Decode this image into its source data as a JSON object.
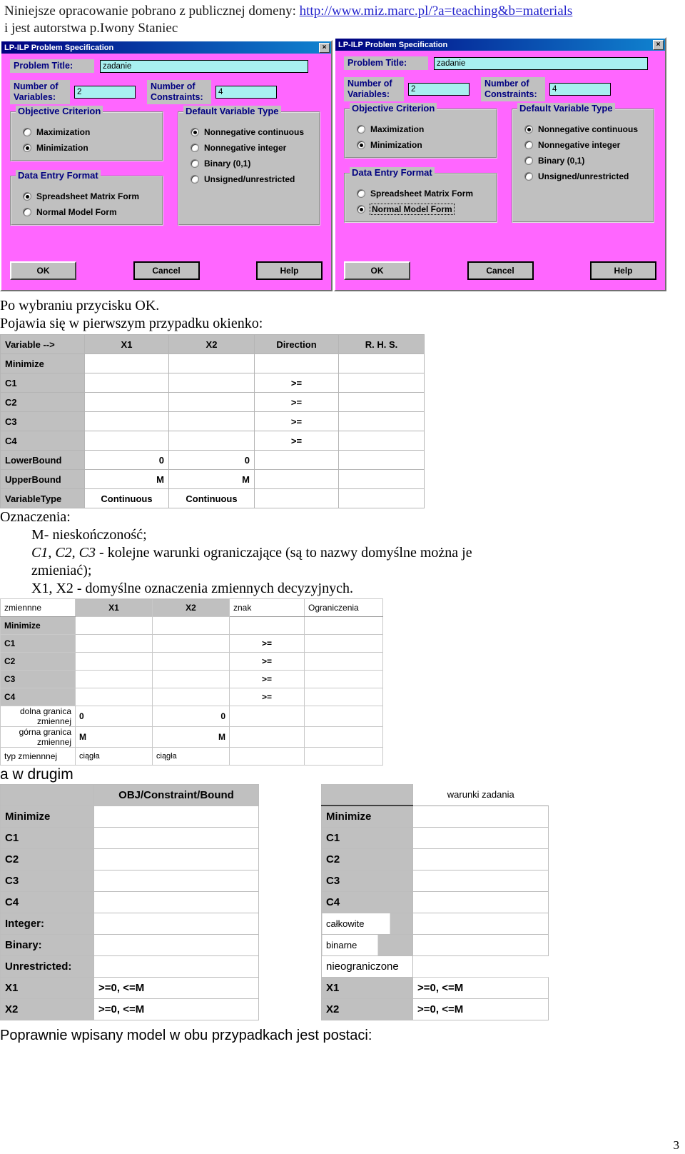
{
  "header": {
    "line1_prefix": "Niniejsze opracowanie pobrano z publicznej domeny: ",
    "link_text": "http://www.miz.marc.pl/?a=teaching&b=materials",
    "line2": "i jest autorstwa p.Iwony Staniec"
  },
  "dialog": {
    "title": "LP-ILP Problem Specification",
    "close_label": "×",
    "problem_title_label": "Problem Title:",
    "problem_title_value": "zadanie",
    "num_variables_label": "Number of\nVariables:",
    "num_variables_label_l1": "Number of",
    "num_variables_label_l2": "Variables:",
    "num_variables_value": "2",
    "num_constraints_label_l1": "Number of",
    "num_constraints_label_l2": "Constraints:",
    "num_constraints_value": "4",
    "objective_group": "Objective Criterion",
    "objective_options": [
      "Maximization",
      "Minimization"
    ],
    "data_entry_group": "Data Entry Format",
    "data_entry_options": [
      "Spreadsheet Matrix Form",
      "Normal Model Form"
    ],
    "variable_type_group": "Default Variable Type",
    "variable_type_options": [
      "Nonnegative continuous",
      "Nonnegative integer",
      "Binary (0,1)",
      "Unsigned/unrestricted"
    ],
    "buttons": {
      "ok": "OK",
      "cancel": "Cancel",
      "help": "Help"
    },
    "instance_a": {
      "objective_selected": 1,
      "data_entry_selected": 0,
      "variable_type_selected": 0
    },
    "instance_b": {
      "objective_selected": 1,
      "data_entry_selected": 1,
      "variable_type_selected": 0
    }
  },
  "body": {
    "after_ok": "Po wybraniu przycisku OK.",
    "first_case": "Pojawia się w pierwszym przypadku okienko:",
    "legend_title": "Oznaczenia:",
    "legend_m": "M- nieskończoność;",
    "legend_c_italic": "C1, C2, C3",
    "legend_c_rest": " - kolejne warunki ograniczające (są to nazwy domyślne można je",
    "legend_c_rest2": "zmieniać);",
    "legend_x": "X1, X2 - domyślne oznaczenia zmiennych decyzyjnych.",
    "second_case": "a w drugim",
    "closing": "Poprawnie wpisany model w obu przypadkach jest postaci:",
    "page_number": "3"
  },
  "table_spreadsheet_en": {
    "columns": [
      "Variable -->",
      "X1",
      "X2",
      "Direction",
      "R. H. S."
    ],
    "rows": [
      {
        "label": "Minimize",
        "x1": "",
        "x2": "",
        "dir": "",
        "rhs": "",
        "selected": true
      },
      {
        "label": "C1",
        "x1": "",
        "x2": "",
        "dir": ">=",
        "rhs": ""
      },
      {
        "label": "C2",
        "x1": "",
        "x2": "",
        "dir": ">=",
        "rhs": ""
      },
      {
        "label": "C3",
        "x1": "",
        "x2": "",
        "dir": ">=",
        "rhs": ""
      },
      {
        "label": "C4",
        "x1": "",
        "x2": "",
        "dir": ">=",
        "rhs": ""
      },
      {
        "label": "LowerBound",
        "x1": "0",
        "x2": "0",
        "dir": "",
        "rhs": ""
      },
      {
        "label": "UpperBound",
        "x1": "M",
        "x2": "M",
        "dir": "",
        "rhs": ""
      },
      {
        "label": "VariableType",
        "x1": "Continuous",
        "x2": "Continuous",
        "dir": "",
        "rhs": ""
      }
    ]
  },
  "table_spreadsheet_pl": {
    "columns": [
      "zmiennne",
      "X1",
      "X2",
      "znak",
      "Ograniczenia"
    ],
    "rows": [
      {
        "label": "Minimize",
        "x1": "",
        "x2": "",
        "dir": "",
        "rhs": "",
        "selected": true
      },
      {
        "label": "C1",
        "x1": "",
        "x2": "",
        "dir": ">=",
        "rhs": ""
      },
      {
        "label": "C2",
        "x1": "",
        "x2": "",
        "dir": ">=",
        "rhs": ""
      },
      {
        "label": "C3",
        "x1": "",
        "x2": "",
        "dir": ">=",
        "rhs": ""
      },
      {
        "label": "C4",
        "x1": "",
        "x2": "",
        "dir": ">=",
        "rhs": ""
      },
      {
        "label": "dolna granica zmiennej",
        "x1": "0",
        "x2": "0",
        "dir": "",
        "rhs": ""
      },
      {
        "label": "górna granica zmiennej",
        "x1": "M",
        "x2": "M",
        "dir": "",
        "rhs": ""
      },
      {
        "label": "typ zmiennnej",
        "x1": "ciągła",
        "x2": "ciągła",
        "dir": "",
        "rhs": ""
      }
    ]
  },
  "table_model_en": {
    "header_left": "",
    "header_right": "OBJ/Constraint/Bound",
    "rows": [
      {
        "label": "Minimize",
        "value": "",
        "selected": true
      },
      {
        "label": "C1",
        "value": ""
      },
      {
        "label": "C2",
        "value": ""
      },
      {
        "label": "C3",
        "value": ""
      },
      {
        "label": "C4",
        "value": ""
      },
      {
        "label": "Integer:",
        "value": ""
      },
      {
        "label": "Binary:",
        "value": ""
      },
      {
        "label": "Unrestricted:",
        "value": ""
      },
      {
        "label": "X1",
        "value": ">=0, <=M"
      },
      {
        "label": "X2",
        "value": ">=0, <=M"
      }
    ]
  },
  "table_model_pl": {
    "header_left": "",
    "header_right": "warunki zadania",
    "rows": [
      {
        "label": "Minimize",
        "value": "",
        "selected": true
      },
      {
        "label": "C1",
        "value": ""
      },
      {
        "label": "C2",
        "value": ""
      },
      {
        "label": "C3",
        "value": ""
      },
      {
        "label": "C4",
        "value": ""
      },
      {
        "label": "całkowite",
        "value": "",
        "plain": true
      },
      {
        "label": "binarne",
        "value": "",
        "plain": true
      },
      {
        "label": "nieograniczone",
        "value": "",
        "plain": true,
        "noborder": true
      },
      {
        "label": "X1",
        "value": ">=0, <=M"
      },
      {
        "label": "X2",
        "value": ">=0, <=M"
      }
    ]
  }
}
